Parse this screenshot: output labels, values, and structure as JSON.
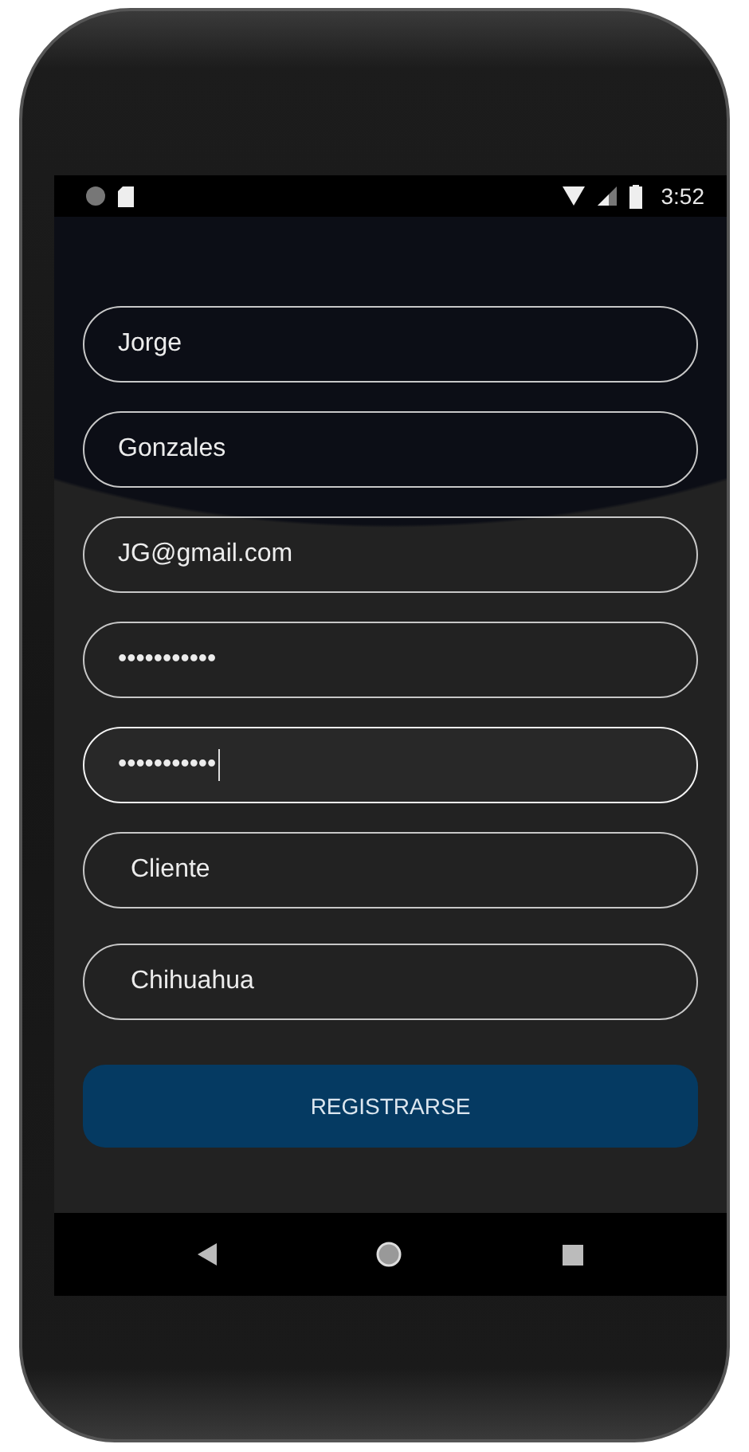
{
  "status_bar": {
    "time": "3:52"
  },
  "form": {
    "fields": [
      {
        "kind": "input",
        "value": "Jorge",
        "focused": false
      },
      {
        "kind": "input",
        "value": "Gonzales",
        "focused": false
      },
      {
        "kind": "input",
        "value": "JG@gmail.com",
        "focused": false
      },
      {
        "kind": "input",
        "value": "•••••••••••",
        "focused": false
      },
      {
        "kind": "input",
        "value": "•••••••••••",
        "focused": true
      },
      {
        "kind": "spinner",
        "value": "Cliente",
        "focused": false
      },
      {
        "kind": "spinner",
        "value": "Chihuahua",
        "focused": false
      }
    ],
    "submit": {
      "label": "REGISTRARSE"
    }
  }
}
